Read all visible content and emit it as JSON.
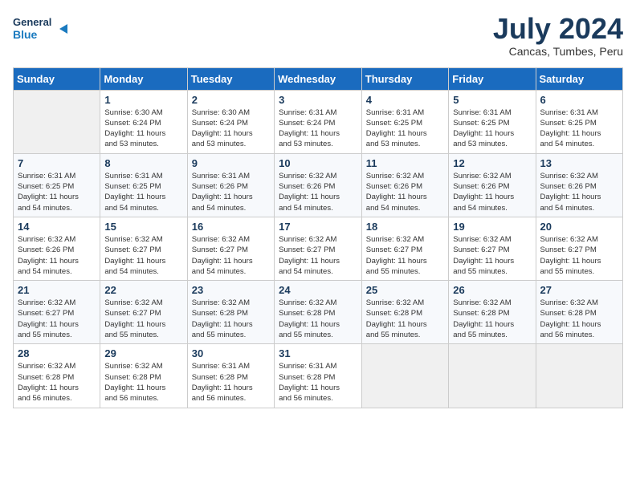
{
  "header": {
    "logo_line1": "General",
    "logo_line2": "Blue",
    "main_title": "July 2024",
    "subtitle": "Cancas, Tumbes, Peru"
  },
  "weekdays": [
    "Sunday",
    "Monday",
    "Tuesday",
    "Wednesday",
    "Thursday",
    "Friday",
    "Saturday"
  ],
  "weeks": [
    [
      {
        "day": "",
        "info": ""
      },
      {
        "day": "1",
        "info": "Sunrise: 6:30 AM\nSunset: 6:24 PM\nDaylight: 11 hours\nand 53 minutes."
      },
      {
        "day": "2",
        "info": "Sunrise: 6:30 AM\nSunset: 6:24 PM\nDaylight: 11 hours\nand 53 minutes."
      },
      {
        "day": "3",
        "info": "Sunrise: 6:31 AM\nSunset: 6:24 PM\nDaylight: 11 hours\nand 53 minutes."
      },
      {
        "day": "4",
        "info": "Sunrise: 6:31 AM\nSunset: 6:25 PM\nDaylight: 11 hours\nand 53 minutes."
      },
      {
        "day": "5",
        "info": "Sunrise: 6:31 AM\nSunset: 6:25 PM\nDaylight: 11 hours\nand 53 minutes."
      },
      {
        "day": "6",
        "info": "Sunrise: 6:31 AM\nSunset: 6:25 PM\nDaylight: 11 hours\nand 54 minutes."
      }
    ],
    [
      {
        "day": "7",
        "info": "Sunrise: 6:31 AM\nSunset: 6:25 PM\nDaylight: 11 hours\nand 54 minutes."
      },
      {
        "day": "8",
        "info": "Sunrise: 6:31 AM\nSunset: 6:25 PM\nDaylight: 11 hours\nand 54 minutes."
      },
      {
        "day": "9",
        "info": "Sunrise: 6:31 AM\nSunset: 6:26 PM\nDaylight: 11 hours\nand 54 minutes."
      },
      {
        "day": "10",
        "info": "Sunrise: 6:32 AM\nSunset: 6:26 PM\nDaylight: 11 hours\nand 54 minutes."
      },
      {
        "day": "11",
        "info": "Sunrise: 6:32 AM\nSunset: 6:26 PM\nDaylight: 11 hours\nand 54 minutes."
      },
      {
        "day": "12",
        "info": "Sunrise: 6:32 AM\nSunset: 6:26 PM\nDaylight: 11 hours\nand 54 minutes."
      },
      {
        "day": "13",
        "info": "Sunrise: 6:32 AM\nSunset: 6:26 PM\nDaylight: 11 hours\nand 54 minutes."
      }
    ],
    [
      {
        "day": "14",
        "info": "Sunrise: 6:32 AM\nSunset: 6:26 PM\nDaylight: 11 hours\nand 54 minutes."
      },
      {
        "day": "15",
        "info": "Sunrise: 6:32 AM\nSunset: 6:27 PM\nDaylight: 11 hours\nand 54 minutes."
      },
      {
        "day": "16",
        "info": "Sunrise: 6:32 AM\nSunset: 6:27 PM\nDaylight: 11 hours\nand 54 minutes."
      },
      {
        "day": "17",
        "info": "Sunrise: 6:32 AM\nSunset: 6:27 PM\nDaylight: 11 hours\nand 54 minutes."
      },
      {
        "day": "18",
        "info": "Sunrise: 6:32 AM\nSunset: 6:27 PM\nDaylight: 11 hours\nand 55 minutes."
      },
      {
        "day": "19",
        "info": "Sunrise: 6:32 AM\nSunset: 6:27 PM\nDaylight: 11 hours\nand 55 minutes."
      },
      {
        "day": "20",
        "info": "Sunrise: 6:32 AM\nSunset: 6:27 PM\nDaylight: 11 hours\nand 55 minutes."
      }
    ],
    [
      {
        "day": "21",
        "info": "Sunrise: 6:32 AM\nSunset: 6:27 PM\nDaylight: 11 hours\nand 55 minutes."
      },
      {
        "day": "22",
        "info": "Sunrise: 6:32 AM\nSunset: 6:27 PM\nDaylight: 11 hours\nand 55 minutes."
      },
      {
        "day": "23",
        "info": "Sunrise: 6:32 AM\nSunset: 6:28 PM\nDaylight: 11 hours\nand 55 minutes."
      },
      {
        "day": "24",
        "info": "Sunrise: 6:32 AM\nSunset: 6:28 PM\nDaylight: 11 hours\nand 55 minutes."
      },
      {
        "day": "25",
        "info": "Sunrise: 6:32 AM\nSunset: 6:28 PM\nDaylight: 11 hours\nand 55 minutes."
      },
      {
        "day": "26",
        "info": "Sunrise: 6:32 AM\nSunset: 6:28 PM\nDaylight: 11 hours\nand 55 minutes."
      },
      {
        "day": "27",
        "info": "Sunrise: 6:32 AM\nSunset: 6:28 PM\nDaylight: 11 hours\nand 56 minutes."
      }
    ],
    [
      {
        "day": "28",
        "info": "Sunrise: 6:32 AM\nSunset: 6:28 PM\nDaylight: 11 hours\nand 56 minutes."
      },
      {
        "day": "29",
        "info": "Sunrise: 6:32 AM\nSunset: 6:28 PM\nDaylight: 11 hours\nand 56 minutes."
      },
      {
        "day": "30",
        "info": "Sunrise: 6:31 AM\nSunset: 6:28 PM\nDaylight: 11 hours\nand 56 minutes."
      },
      {
        "day": "31",
        "info": "Sunrise: 6:31 AM\nSunset: 6:28 PM\nDaylight: 11 hours\nand 56 minutes."
      },
      {
        "day": "",
        "info": ""
      },
      {
        "day": "",
        "info": ""
      },
      {
        "day": "",
        "info": ""
      }
    ]
  ]
}
